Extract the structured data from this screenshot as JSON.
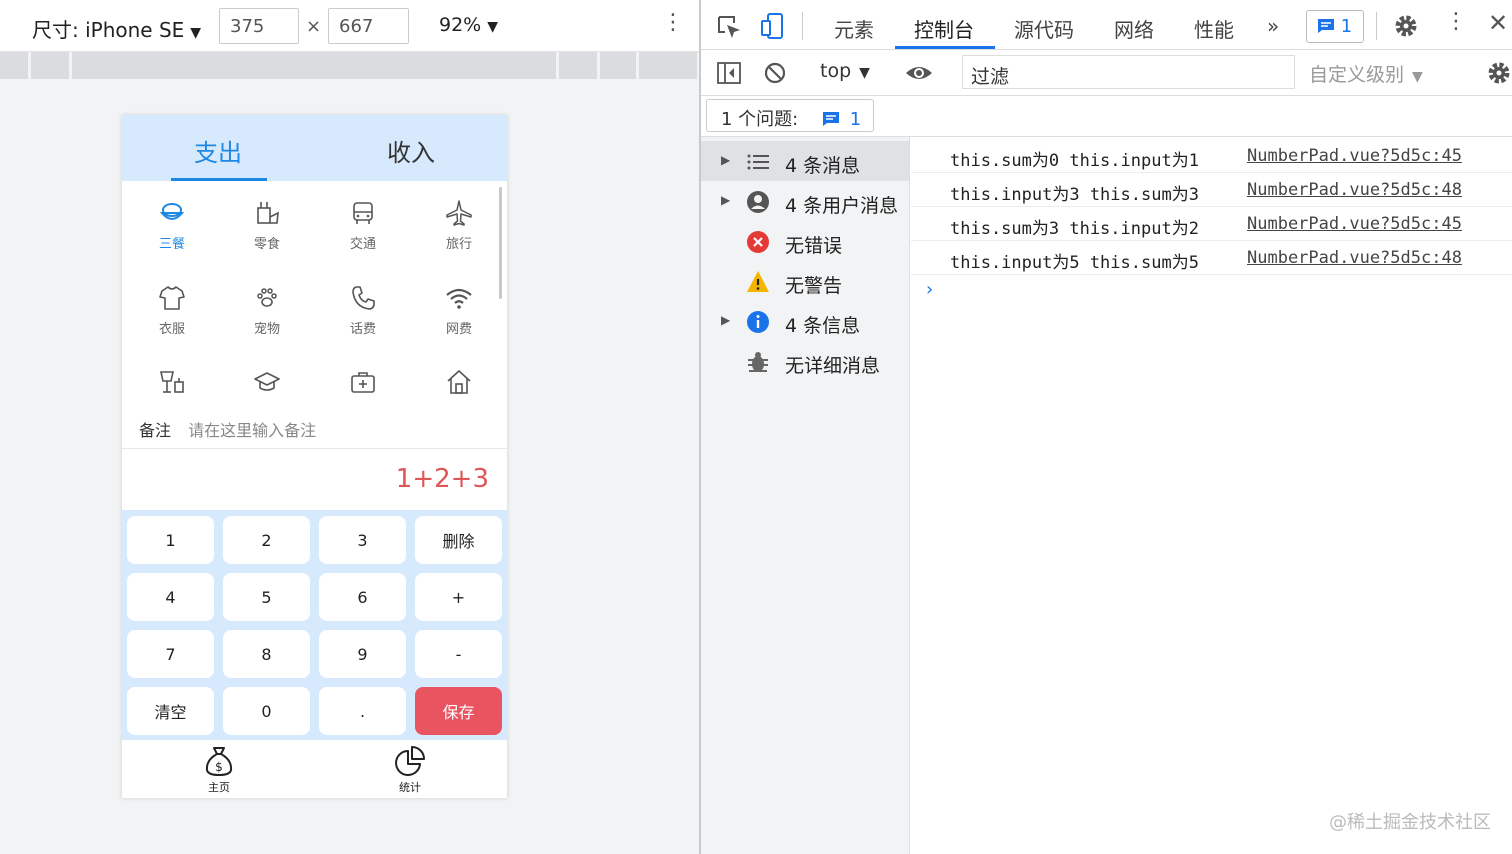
{
  "device_toolbar": {
    "size_label": "尺寸: iPhone SE",
    "width": "375",
    "height": "667",
    "times": "×",
    "zoom": "92%"
  },
  "app": {
    "tabs": [
      "支出",
      "收入"
    ],
    "active_tab": "支出",
    "categories": [
      {
        "label": "三餐",
        "icon": "meal-icon",
        "active": true
      },
      {
        "label": "零食",
        "icon": "snack-icon"
      },
      {
        "label": "交通",
        "icon": "bus-icon"
      },
      {
        "label": "旅行",
        "icon": "airplane-icon"
      },
      {
        "label": "衣服",
        "icon": "shirt-icon"
      },
      {
        "label": "宠物",
        "icon": "paw-icon"
      },
      {
        "label": "话费",
        "icon": "phone-icon"
      },
      {
        "label": "网费",
        "icon": "wifi-icon"
      },
      {
        "label": "",
        "icon": "dining-icon"
      },
      {
        "label": "",
        "icon": "graduation-cap-icon"
      },
      {
        "label": "",
        "icon": "medical-kit-icon"
      },
      {
        "label": "",
        "icon": "house-icon"
      }
    ],
    "note_label": "备注",
    "note_placeholder": "请在这里输入备注",
    "amount_display": "1+2+3",
    "keys": [
      "1",
      "2",
      "3",
      "删除",
      "4",
      "5",
      "6",
      "+",
      "7",
      "8",
      "9",
      "-",
      "清空",
      "0",
      ".",
      "保存"
    ],
    "nav": [
      {
        "label": "主页",
        "icon": "money-bag-icon"
      },
      {
        "label": "统计",
        "icon": "pie-chart-icon"
      }
    ],
    "accent_color": "#1e88e5",
    "save_color": "#e85560"
  },
  "devtools": {
    "tabs": [
      "元素",
      "控制台",
      "源代码",
      "网络",
      "性能"
    ],
    "selected_tab": "控制台",
    "more": "»",
    "issue_count": "1",
    "context": "top",
    "filter_placeholder": "过滤",
    "levels": "自定义级别",
    "issues_label": "1 个问题:",
    "issues_count": "1",
    "sidebar": [
      {
        "label": "4 条消息",
        "icon": "list-icon",
        "expandable": true,
        "selected": true
      },
      {
        "label": "4 条用户消息",
        "icon": "user-icon",
        "expandable": true
      },
      {
        "label": "无错误",
        "icon": "error-icon",
        "expandable": false
      },
      {
        "label": "无警告",
        "icon": "warning-icon",
        "expandable": false
      },
      {
        "label": "4 条信息",
        "icon": "info-icon",
        "expandable": true
      },
      {
        "label": "无详细消息",
        "icon": "bug-icon",
        "expandable": false
      }
    ],
    "logs": [
      {
        "message": "this.sum为0 this.input为1",
        "source": "NumberPad.vue?5d5c:45"
      },
      {
        "message": "this.input为3 this.sum为3",
        "source": "NumberPad.vue?5d5c:48"
      },
      {
        "message": "this.sum为3 this.input为2",
        "source": "NumberPad.vue?5d5c:45"
      },
      {
        "message": "this.input为5 this.sum为5",
        "source": "NumberPad.vue?5d5c:48"
      }
    ],
    "prompt": "›"
  },
  "watermark": "@稀土掘金技术社区"
}
